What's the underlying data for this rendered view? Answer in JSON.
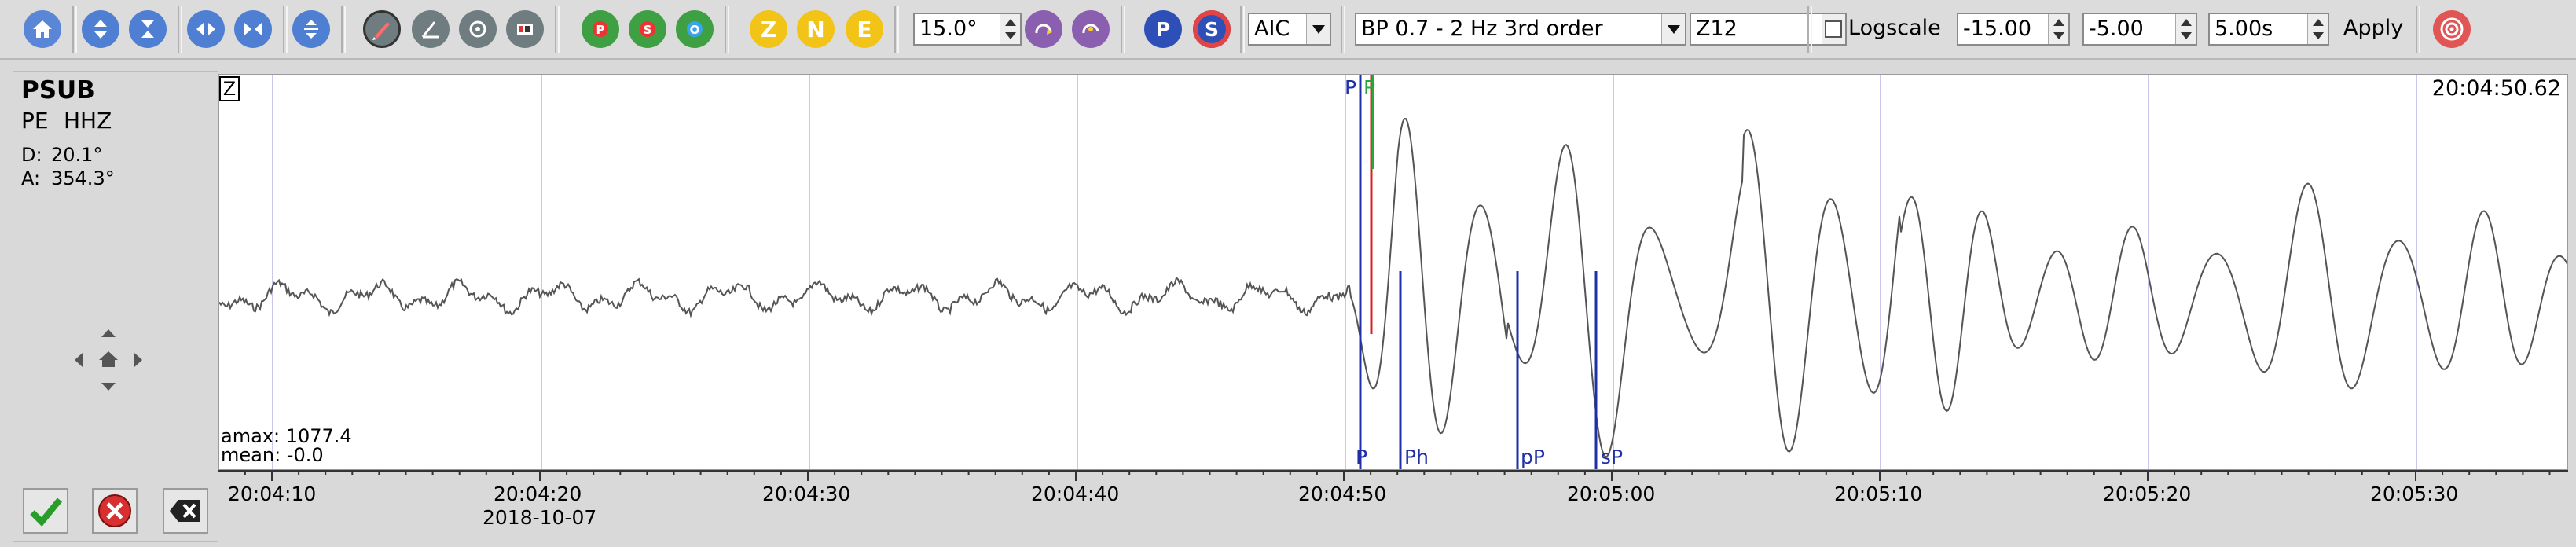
{
  "toolbar": {
    "azimuth": "15.0°",
    "picker_method": "AIC",
    "filter": "BP 0.7 - 2 Hz  3rd order",
    "component_mode": "Z12",
    "logscale_label": "Logscale",
    "logscale_checked": false,
    "min_value": "-15.00",
    "max_value": "-5.00",
    "time_window": "5.00s",
    "apply_label": "Apply",
    "component_buttons": [
      "Z",
      "N",
      "E"
    ],
    "phase_buttons": [
      "P",
      "S"
    ]
  },
  "station": {
    "code": "PSUB",
    "network": "PE",
    "channel": "HHZ",
    "distance_label": "D:",
    "distance": "20.1°",
    "azimuth_label": "A:",
    "azimuth": "354.3°"
  },
  "trace": {
    "component_tag": "Z",
    "end_time": "20:04:50.62",
    "amax": "amax: 1077.4",
    "mean": "mean: -0.0",
    "top_markers": [
      "P",
      "P"
    ],
    "bottom_markers": [
      "P",
      "Ph",
      "pP",
      "sP"
    ]
  },
  "axis": {
    "ticks": [
      "20:04:10",
      "20:04:20",
      "20:04:30",
      "20:04:40",
      "20:04:50",
      "20:05:00",
      "20:05:10",
      "20:05:20",
      "20:05:30"
    ],
    "date": "2018-10-07"
  },
  "colors": {
    "pick_blue": "#1f2fa8",
    "pick_red": "#d92020",
    "pick_green": "#27a83a",
    "grid": "#c8c8ee",
    "trace": "#555555"
  }
}
